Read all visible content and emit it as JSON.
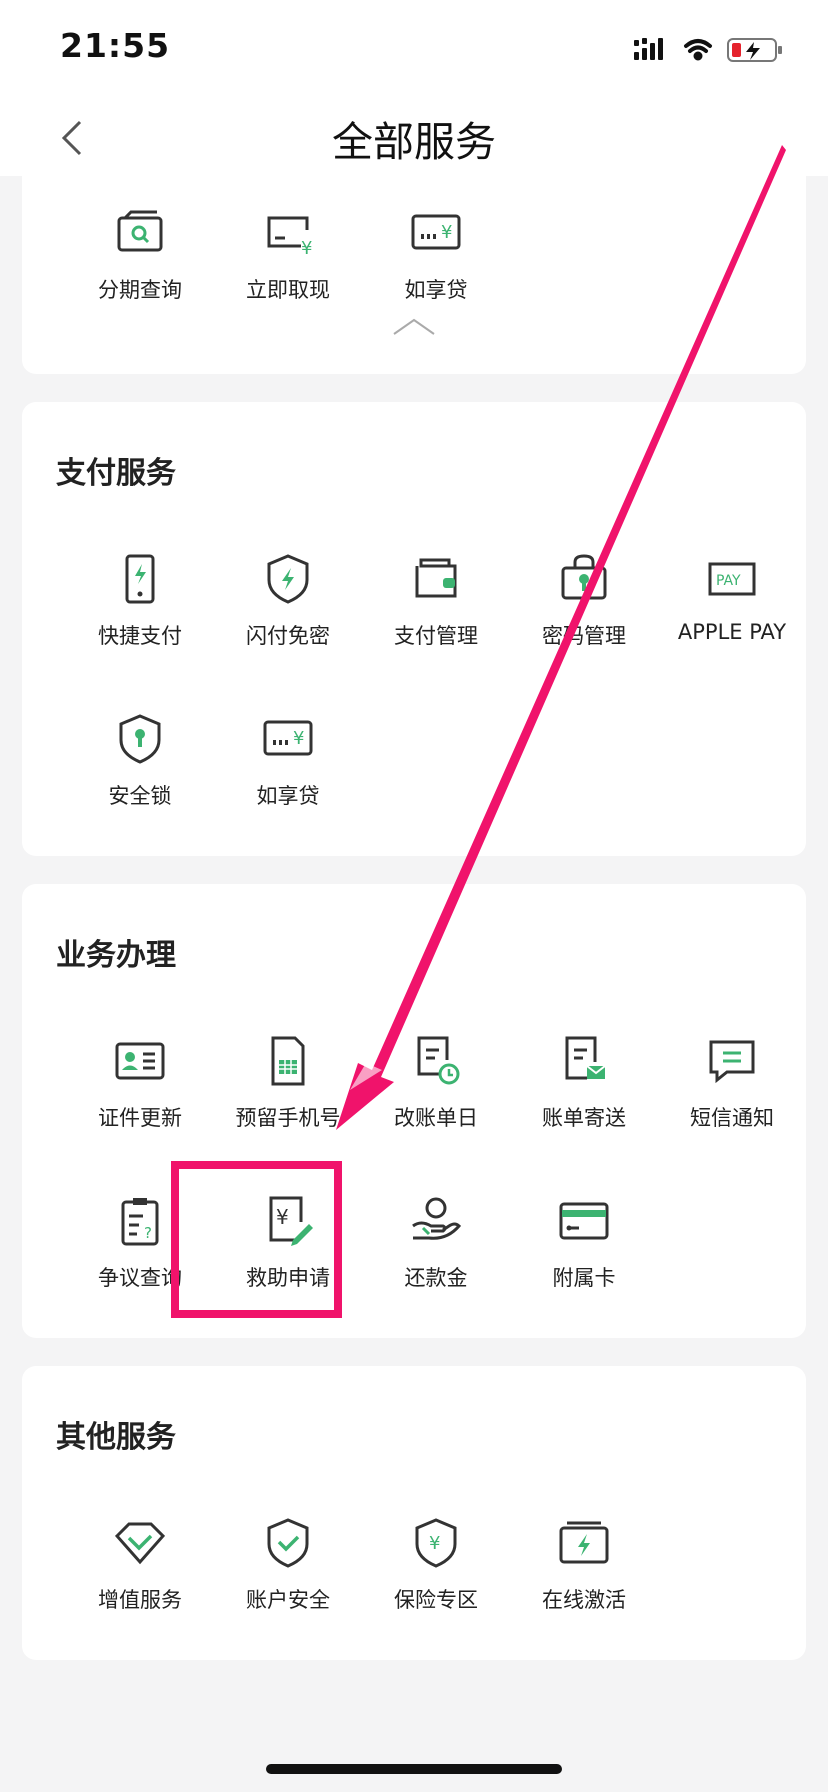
{
  "status_bar": {
    "time": "21:55"
  },
  "header": {
    "title": "全部服务"
  },
  "loan_section": {
    "items": [
      {
        "label": "分期查询",
        "icon": "installment-query-icon"
      },
      {
        "label": "立即取现",
        "icon": "cash-withdraw-icon"
      },
      {
        "label": "如享贷",
        "icon": "loan-icon"
      }
    ]
  },
  "payment_section": {
    "title": "支付服务",
    "items": [
      {
        "label": "快捷支付",
        "icon": "quick-pay-icon"
      },
      {
        "label": "闪付免密",
        "icon": "flash-pay-icon"
      },
      {
        "label": "支付管理",
        "icon": "wallet-icon"
      },
      {
        "label": "密码管理",
        "icon": "password-icon"
      },
      {
        "label": "APPLE PAY",
        "icon": "apple-pay-icon"
      },
      {
        "label": "安全锁",
        "icon": "security-lock-icon"
      },
      {
        "label": "如享贷",
        "icon": "loan-icon"
      }
    ]
  },
  "business_section": {
    "title": "业务办理",
    "items": [
      {
        "label": "证件更新",
        "icon": "id-card-icon"
      },
      {
        "label": "预留手机号",
        "icon": "sim-card-icon"
      },
      {
        "label": "改账单日",
        "icon": "bill-date-icon"
      },
      {
        "label": "账单寄送",
        "icon": "bill-mail-icon"
      },
      {
        "label": "短信通知",
        "icon": "sms-icon"
      },
      {
        "label": "争议查询",
        "icon": "dispute-icon"
      },
      {
        "label": "救助申请",
        "icon": "relief-application-icon"
      },
      {
        "label": "还款金",
        "icon": "repayment-icon"
      },
      {
        "label": "附属卡",
        "icon": "supplementary-card-icon"
      }
    ]
  },
  "other_section": {
    "title": "其他服务",
    "items": [
      {
        "label": "增值服务",
        "icon": "diamond-icon"
      },
      {
        "label": "账户安全",
        "icon": "shield-check-icon"
      },
      {
        "label": "保险专区",
        "icon": "insurance-icon"
      },
      {
        "label": "在线激活",
        "icon": "activate-card-icon"
      }
    ]
  },
  "colors": {
    "accent_green": "#3cb371",
    "highlight": "#f0136b",
    "icon_dark": "#333333"
  }
}
